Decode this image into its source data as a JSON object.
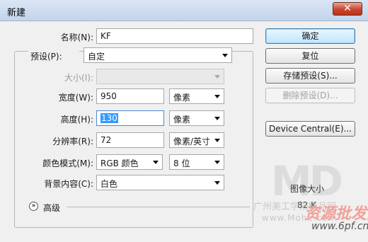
{
  "window": {
    "title": "新建",
    "close_glyph": "✕"
  },
  "form": {
    "name": {
      "label": "名称(N):",
      "value": "KF"
    },
    "preset": {
      "label": "预设(P):",
      "value": "自定"
    },
    "size": {
      "label": "大小(I):",
      "value": ""
    },
    "width": {
      "label": "宽度(W):",
      "value": "950",
      "unit": "像素"
    },
    "height": {
      "label": "高度(H):",
      "value": "130",
      "unit": "像素"
    },
    "resolution": {
      "label": "分辨率(R):",
      "value": "72",
      "unit": "像素/英寸"
    },
    "color_mode": {
      "label": "颜色模式(M):",
      "value": "RGB 颜色",
      "depth": "8 位"
    },
    "background": {
      "label": "背景内容(C):",
      "value": "白色"
    },
    "advanced": {
      "label": "高级"
    }
  },
  "buttons": {
    "ok": "确定",
    "reset": "复位",
    "save_preset": "存储预设(S)...",
    "delete_preset": "删除预设(D)...",
    "device_central": "Device Central(E)..."
  },
  "image_size": {
    "label": "图像大小"
  },
  "watermark": {
    "line1": "广州美工学院精品网",
    "line2": "www.Mohe.com",
    "logo": "MD",
    "site_cn": "资源批发网",
    "site_url": "www.6pf.cn",
    "pixel_fragment": "82.K"
  },
  "colors": {
    "title_bar": "#c3d4ea",
    "selection": "#3399ff",
    "watermark_red": "#f3a19a"
  },
  "icons": {
    "close": "close-icon",
    "expand": "expand-chevron-icon"
  }
}
